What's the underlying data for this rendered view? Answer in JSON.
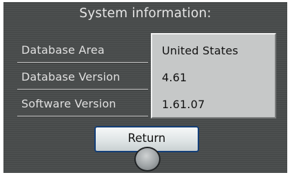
{
  "header": {
    "title": "System information:"
  },
  "rows": [
    {
      "label": "Database Area",
      "value": "United States"
    },
    {
      "label": "Database Version",
      "value": "4.61"
    },
    {
      "label": "Software Version",
      "value": "1.61.07"
    }
  ],
  "actions": {
    "return_label": "Return"
  },
  "colors": {
    "button_border": "#123e78",
    "panel_bg": "#c6c8c8",
    "screen_bg": "#4a4d4d"
  }
}
